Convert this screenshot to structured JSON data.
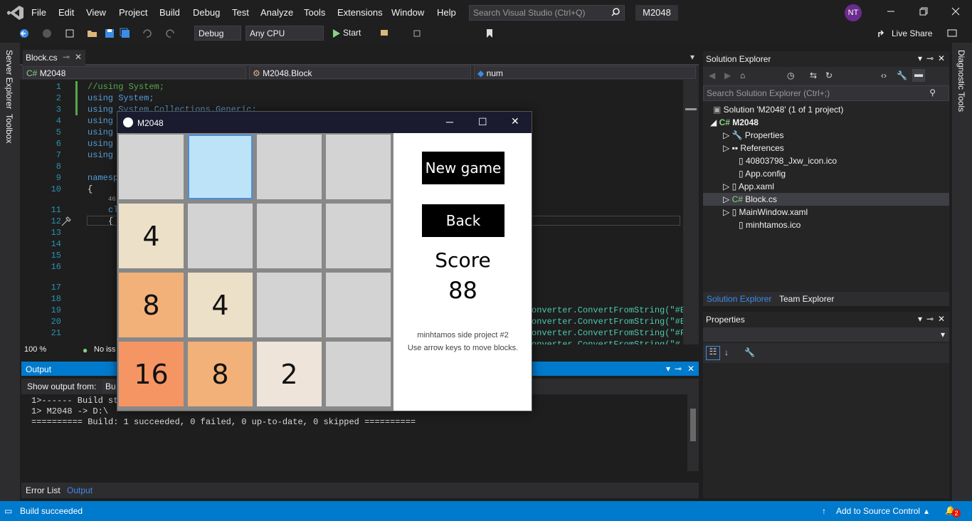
{
  "menubar": {
    "items": [
      "File",
      "Edit",
      "View",
      "Project",
      "Build",
      "Debug",
      "Test",
      "Analyze",
      "Tools",
      "Extensions",
      "Window",
      "Help"
    ],
    "search_placeholder": "Search Visual Studio (Ctrl+Q)",
    "solution_badge": "M2048",
    "avatar_initials": "NT"
  },
  "toolbar": {
    "config": "Debug",
    "platform": "Any CPU",
    "start_label": "Start",
    "live_share": "Live Share"
  },
  "left_tabs": [
    "Server Explorer",
    "Toolbox"
  ],
  "right_tabs": [
    "Diagnostic Tools"
  ],
  "editor": {
    "tab_name": "Block.cs",
    "nav_project": "M2048",
    "nav_class": "M2048.Block",
    "nav_member": "num",
    "zoom": "100 %",
    "issues": "No iss",
    "line_numbers": [
      "1",
      "2",
      "3",
      "4",
      "5",
      "6",
      "7",
      "8",
      "9",
      "10",
      "",
      "11",
      "12",
      "13",
      "14",
      "15",
      "16",
      "",
      "17",
      "18",
      "19",
      "20",
      "21",
      "22"
    ],
    "lines": [
      "//using System;",
      "using System;",
      "using System.Collections.Generic;",
      "using",
      "using",
      "using",
      "using",
      "",
      "namesp",
      "{",
      "46",
      "cl",
      "{"
    ],
    "right_code": [
      "onverter.ConvertFromString(\"#E",
      "onverter.ConvertFromString(\"#E",
      "onverter.ConvertFromString(\"#F",
      "onverter.ConvertFromString(\"#"
    ]
  },
  "output": {
    "title": "Output",
    "show_from_label": "Show output from:",
    "show_from_value": "Bu",
    "lines": [
      "1>------ Build st",
      "1>  M2048 -> D:\\",
      "========== Build: 1 succeeded, 0 failed, 0 up-to-date, 0 skipped =========="
    ]
  },
  "bottom_tabs": [
    "Error List",
    "Output"
  ],
  "solution_explorer": {
    "title": "Solution Explorer",
    "search_placeholder": "Search Solution Explorer (Ctrl+;)",
    "solution": "Solution 'M2048' (1 of 1 project)",
    "project": "M2048",
    "items": [
      "Properties",
      "References",
      "40803798_Jxw_icon.ico",
      "App.config",
      "App.xaml",
      "Block.cs",
      "MainWindow.xaml",
      "minhtamos.ico"
    ],
    "tabs": [
      "Solution Explorer",
      "Team Explorer"
    ]
  },
  "properties": {
    "title": "Properties"
  },
  "statusbar": {
    "message": "Build succeeded",
    "source_control": "Add to Source Control",
    "notif_count": "2"
  },
  "game": {
    "title": "M2048",
    "tiles": [
      [
        "",
        "",
        "",
        ""
      ],
      [
        "4",
        "",
        "",
        ""
      ],
      [
        "8",
        "4",
        "",
        ""
      ],
      [
        "16",
        "8",
        "2",
        ""
      ]
    ],
    "tile_colors": [
      [
        "#d3d3d3",
        "#bde3f8",
        "#d3d3d3",
        "#d3d3d3"
      ],
      [
        "#ede0c8",
        "#d3d3d3",
        "#d3d3d3",
        "#d3d3d3"
      ],
      [
        "#f2b179",
        "#ede0c8",
        "#d3d3d3",
        "#d3d3d3"
      ],
      [
        "#f59563",
        "#f2b179",
        "#eee4da",
        "#d3d3d3"
      ]
    ],
    "new_game": "New game",
    "back": "Back",
    "score_label": "Score",
    "score_value": "88",
    "footer_line1": "minhtamos side project #2",
    "footer_line2": "Use arrow keys to move blocks."
  },
  "colors": {
    "accent": "#007acc",
    "bg": "#1e1e1e"
  }
}
